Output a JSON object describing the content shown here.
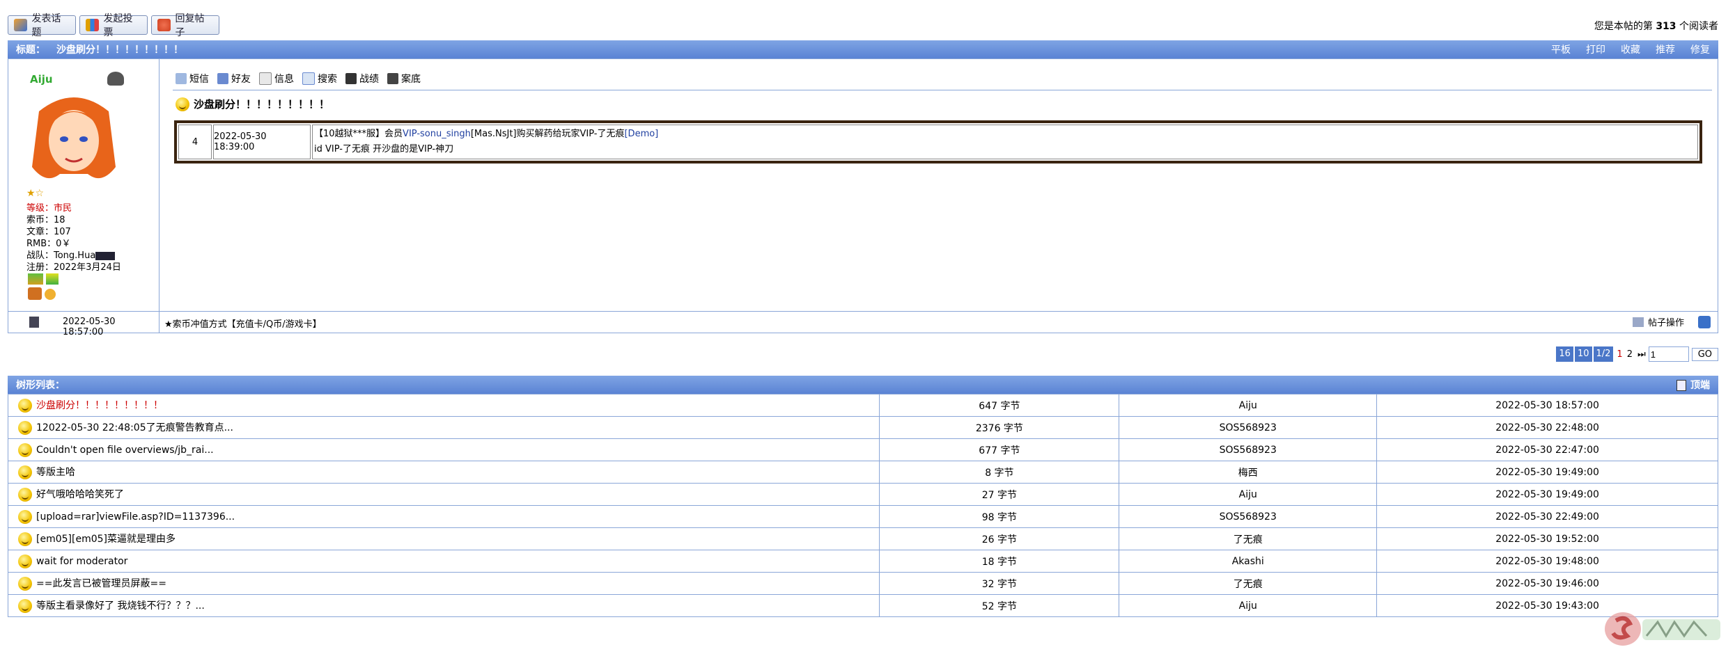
{
  "toolbar": {
    "new_topic": "发表话题",
    "new_poll": "发起投票",
    "reply": "回复帖子",
    "reader_prefix": "您是本帖的第",
    "reader_count": "313",
    "reader_suffix": "个阅读者"
  },
  "topic_bar": {
    "label": "标题：",
    "title": "沙盘刷分！！！！！！！！！",
    "actions": [
      "平板",
      "打印",
      "收藏",
      "推荐",
      "修复"
    ]
  },
  "author": {
    "name": "Aiju",
    "stars": "★☆",
    "level_label": "等级：",
    "level_value": "市民",
    "coins": "索币：18",
    "posts": "文章：107",
    "rmb": "RMB：0￥",
    "team": "战队：Tong.Hua",
    "registered": "注册：2022年3月24日",
    "post_time": "2022-05-30 18:57:00"
  },
  "post_tools": [
    "短信",
    "好友",
    "信息",
    "搜索",
    "战绩",
    "案底"
  ],
  "post": {
    "title": "沙盘刷分！！！！！！！！！",
    "log": {
      "index": "4",
      "time": "2022-05-30 18:39:00",
      "line1_prefix": "【10越狱***服】会员",
      "line1_user": "VIP-sonu_singh",
      "line1_middle": "[Mas.NsJt]购买解药给玩家VIP-了无痕",
      "line1_tag": "[Demo]",
      "line2": "id  VIP-了无痕  开沙盘的是VIP-神刀"
    },
    "signature": "★索币冲值方式【充值卡/Q币/游戏卡】",
    "ops": "帖子操作"
  },
  "pagination": {
    "items": [
      "16",
      "10",
      "1/2"
    ],
    "pages": [
      "1",
      "2"
    ],
    "input_value": "1",
    "go": "GO"
  },
  "tree": {
    "label": "树形列表：",
    "right": "顶端",
    "rows": [
      {
        "title": "沙盘刷分！！！！！！！！！",
        "size": "647 字节",
        "author": "Aiju",
        "time": "2022-05-30 18:57:00"
      },
      {
        "title": "12022-05-30 22:48:05了无痕警告教育点...",
        "size": "2376 字节",
        "author": "SOS568923",
        "time": "2022-05-30 22:48:00"
      },
      {
        "title": "Couldn't open file overviews/jb_rai...",
        "size": "677 字节",
        "author": "SOS568923",
        "time": "2022-05-30 22:47:00"
      },
      {
        "title": "等版主哈",
        "size": "8 字节",
        "author": "梅西",
        "time": "2022-05-30 19:49:00"
      },
      {
        "title": "好气哦哈哈哈笑死了",
        "size": "27 字节",
        "author": "Aiju",
        "time": "2022-05-30 19:49:00"
      },
      {
        "title": "[upload=rar]viewFile.asp?ID=1137396...",
        "size": "98 字节",
        "author": "SOS568923",
        "time": "2022-05-30 22:49:00"
      },
      {
        "title": "[em05][em05]菜逼就是理由多",
        "size": "26 字节",
        "author": "了无痕",
        "time": "2022-05-30 19:52:00"
      },
      {
        "title": "wait for moderator",
        "size": "18 字节",
        "author": "Akashi",
        "time": "2022-05-30 19:48:00"
      },
      {
        "title": "==此发言已被管理员屏蔽==",
        "size": "32 字节",
        "author": "了无痕",
        "time": "2022-05-30 19:46:00"
      },
      {
        "title": "等版主看录像好了 我烧钱不行？？？...",
        "size": "52 字节",
        "author": "Aiju",
        "time": "2022-05-30 19:43:00"
      }
    ]
  },
  "colors": {
    "bar_blue": "#5a83d4",
    "border_blue": "#8aa6d8",
    "highlight_red": "#cc0000",
    "link_blue": "#2040a0",
    "log_border": "#3a2410"
  }
}
